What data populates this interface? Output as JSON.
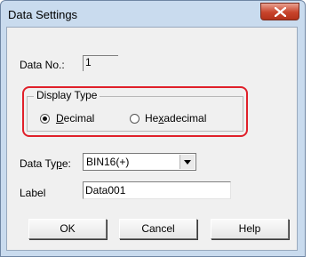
{
  "window": {
    "title": "Data Settings"
  },
  "data_no": {
    "label": "Data No.:",
    "value": "1"
  },
  "display_type": {
    "group_label": "Display Type",
    "options": [
      {
        "label": "Decimal",
        "selected": true
      },
      {
        "label": "Hexadecimal",
        "selected": false
      }
    ]
  },
  "data_type": {
    "label": "Data Type:",
    "value": "BIN16(+)"
  },
  "label_field": {
    "label": "Label",
    "value": "Data001"
  },
  "buttons": {
    "ok": "OK",
    "cancel": "Cancel",
    "help": "Help"
  },
  "colors": {
    "highlight": "#e0202a",
    "close_button": "#c8442c"
  }
}
